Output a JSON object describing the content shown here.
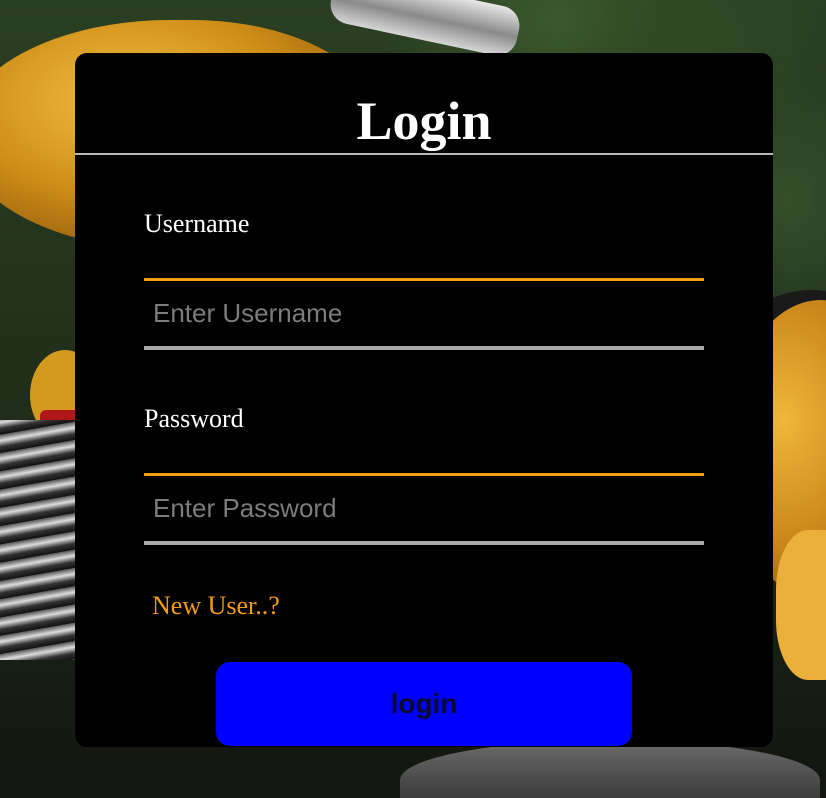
{
  "login_form": {
    "title": "Login",
    "username": {
      "label": "Username",
      "placeholder": "Enter Username",
      "value": ""
    },
    "password": {
      "label": "Password",
      "placeholder": "Enter Password",
      "value": ""
    },
    "new_user_link": "New User..?",
    "submit_label": "login"
  },
  "colors": {
    "card_background": "#000000",
    "accent": "#f39c12",
    "button_background": "#0000ff",
    "input_underline": "#a9a9a9",
    "divider": "#b9b9b9",
    "text": "#ffffff"
  }
}
